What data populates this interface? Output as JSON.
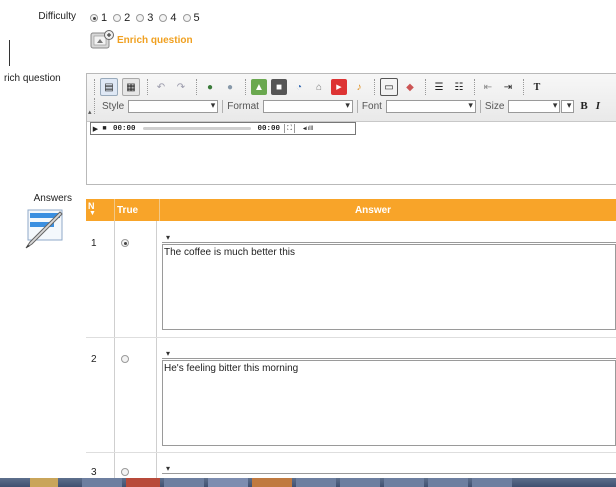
{
  "difficulty": {
    "label": "Difficulty",
    "options": [
      "1",
      "2",
      "3",
      "4",
      "5"
    ],
    "selected": "1"
  },
  "enrich": {
    "button_label": "Enrich question",
    "side_label": "rich question"
  },
  "editor": {
    "style_label": "Style",
    "format_label": "Format",
    "font_label": "Font",
    "size_label": "Size",
    "bold_label": "B",
    "italic_label": "I",
    "player_time_start": "00:00",
    "player_time_end": "00:00"
  },
  "answers": {
    "label": "Answers",
    "headers": {
      "n": "N",
      "sort": "▼",
      "true": "True",
      "answer": "Answer"
    },
    "rows": [
      {
        "number": "1",
        "true": true,
        "text": "The coffee is much better this"
      },
      {
        "number": "2",
        "true": false,
        "text": "He's feeling bitter this morning"
      },
      {
        "number": "3",
        "true": false,
        "text": ""
      }
    ]
  },
  "colors": {
    "accent": "#f8a429",
    "enrich_text": "#f0a020",
    "taskbar": "#4a5b7a"
  }
}
